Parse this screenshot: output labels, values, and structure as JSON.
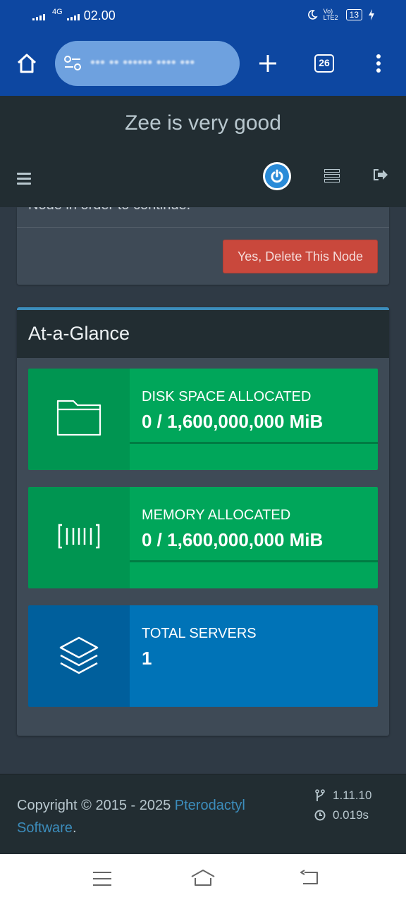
{
  "status_bar": {
    "network": "4G",
    "time": "02.00",
    "volte": "Vo) LTE2",
    "battery": "13"
  },
  "browser": {
    "url": "••• •• •••••• •••• •••",
    "tab_count": "26"
  },
  "app": {
    "brand": "Zee is very good"
  },
  "previous_section": {
    "text": "Node in order to continue.",
    "delete_button": "Yes, Delete This Node"
  },
  "glance": {
    "title": "At-a-Glance",
    "boxes": [
      {
        "label": "DISK SPACE ALLOCATED",
        "value": "0 / 1,600,000,000 MiB",
        "icon": "folder-icon",
        "progress": 0
      },
      {
        "label": "MEMORY ALLOCATED",
        "value": "0 / 1,600,000,000 MiB",
        "icon": "memory-icon",
        "progress": 0
      },
      {
        "label": "TOTAL SERVERS",
        "value": "1",
        "icon": "layers-icon"
      }
    ]
  },
  "footer": {
    "copyright_prefix": "Copyright © 2015 - 2025 ",
    "link_text": "Pterodactyl Software",
    "suffix": ".",
    "version": "1.11.10",
    "time": "0.019s"
  },
  "colors": {
    "green": "#00a65a",
    "green_dark": "#009551",
    "blue": "#0073b7",
    "blue_dark": "#005f9c",
    "danger": "#c9483c",
    "accent": "#3c8dbc",
    "browser": "#0d47a1"
  }
}
